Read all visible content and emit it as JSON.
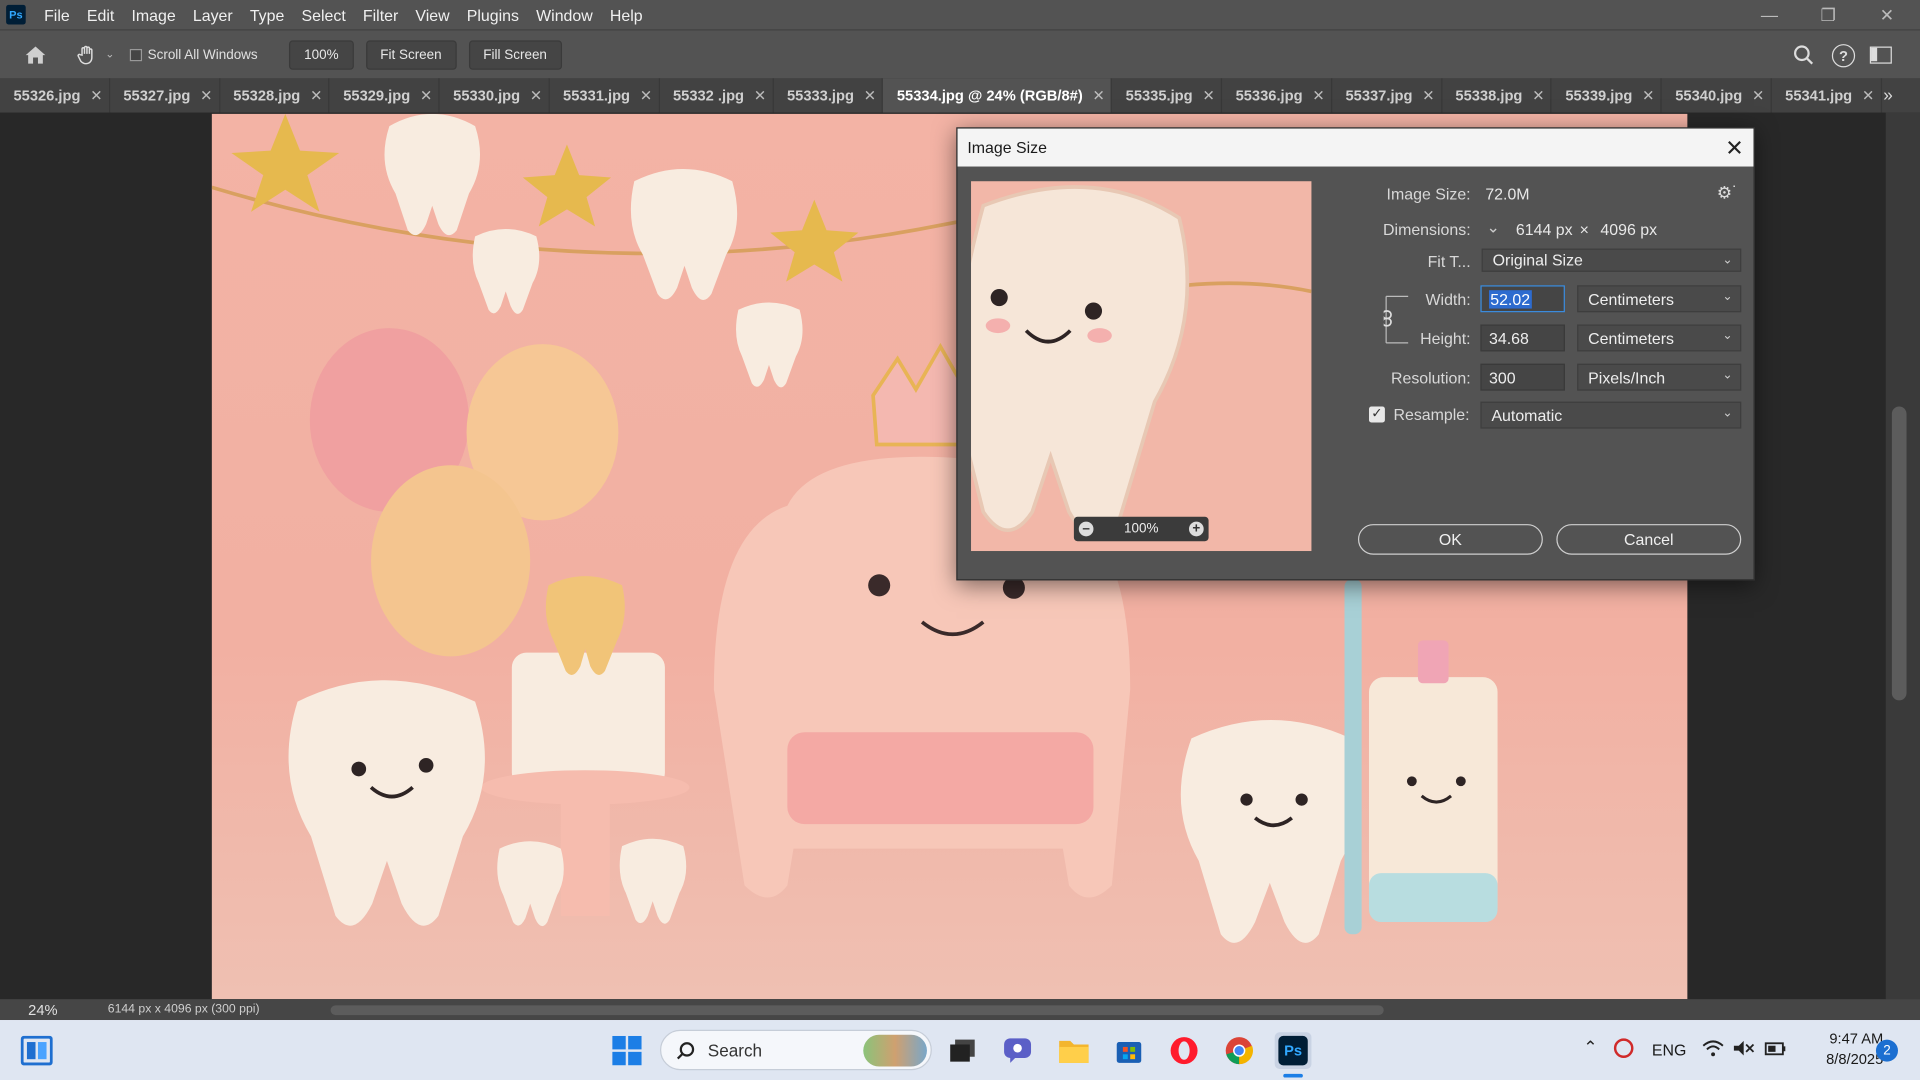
{
  "menubar": {
    "app_badge": "Ps",
    "items": [
      "File",
      "Edit",
      "Image",
      "Layer",
      "Type",
      "Select",
      "Filter",
      "View",
      "Plugins",
      "Window",
      "Help"
    ]
  },
  "options_bar": {
    "scroll_all_windows": "Scroll All Windows",
    "zoom_100": "100%",
    "fit_screen": "Fit Screen",
    "fill_screen": "Fill Screen"
  },
  "tabs": [
    {
      "label": "55326.jpg",
      "active": false
    },
    {
      "label": "55327.jpg",
      "active": false
    },
    {
      "label": "55328.jpg",
      "active": false
    },
    {
      "label": "55329.jpg",
      "active": false
    },
    {
      "label": "55330.jpg",
      "active": false
    },
    {
      "label": "55331.jpg",
      "active": false
    },
    {
      "label": "55332 .jpg",
      "active": false
    },
    {
      "label": "55333.jpg",
      "active": false
    },
    {
      "label": "55334.jpg @ 24% (RGB/8#)",
      "active": true
    },
    {
      "label": "55335.jpg",
      "active": false
    },
    {
      "label": "55336.jpg",
      "active": false
    },
    {
      "label": "55337.jpg",
      "active": false
    },
    {
      "label": "55338.jpg",
      "active": false
    },
    {
      "label": "55339.jpg",
      "active": false
    },
    {
      "label": "55340.jpg",
      "active": false
    },
    {
      "label": "55341.jpg",
      "active": false
    }
  ],
  "tab_overflow": "»",
  "status": {
    "zoom": "24%",
    "doc_info": "6144 px x 4096 px (300 ppi)"
  },
  "dialog": {
    "title": "Image Size",
    "image_size_label": "Image Size:",
    "image_size_value": "72.0M",
    "dimensions_label": "Dimensions:",
    "dim_width": "6144 px",
    "dim_x": "×",
    "dim_height": "4096 px",
    "fit_to_label": "Fit T...",
    "fit_to_value": "Original Size",
    "width_label": "Width:",
    "width_value": "52.02",
    "width_unit": "Centimeters",
    "height_label": "Height:",
    "height_value": "34.68",
    "height_unit": "Centimeters",
    "resolution_label": "Resolution:",
    "resolution_value": "300",
    "resolution_unit": "Pixels/Inch",
    "resample_label": "Resample:",
    "resample_checked": true,
    "resample_value": "Automatic",
    "preview_zoom": "100%",
    "ok": "OK",
    "cancel": "Cancel"
  },
  "taskbar": {
    "search_placeholder": "Search",
    "language": "ENG",
    "time": "9:47 AM",
    "date": "8/8/2025",
    "notification_count": "2"
  },
  "colors": {
    "ps_blue": "#31a8ff",
    "chrome_bg": "#535353",
    "artwork_pink": "#f3b3a5",
    "focus_blue": "#3b8de0"
  }
}
